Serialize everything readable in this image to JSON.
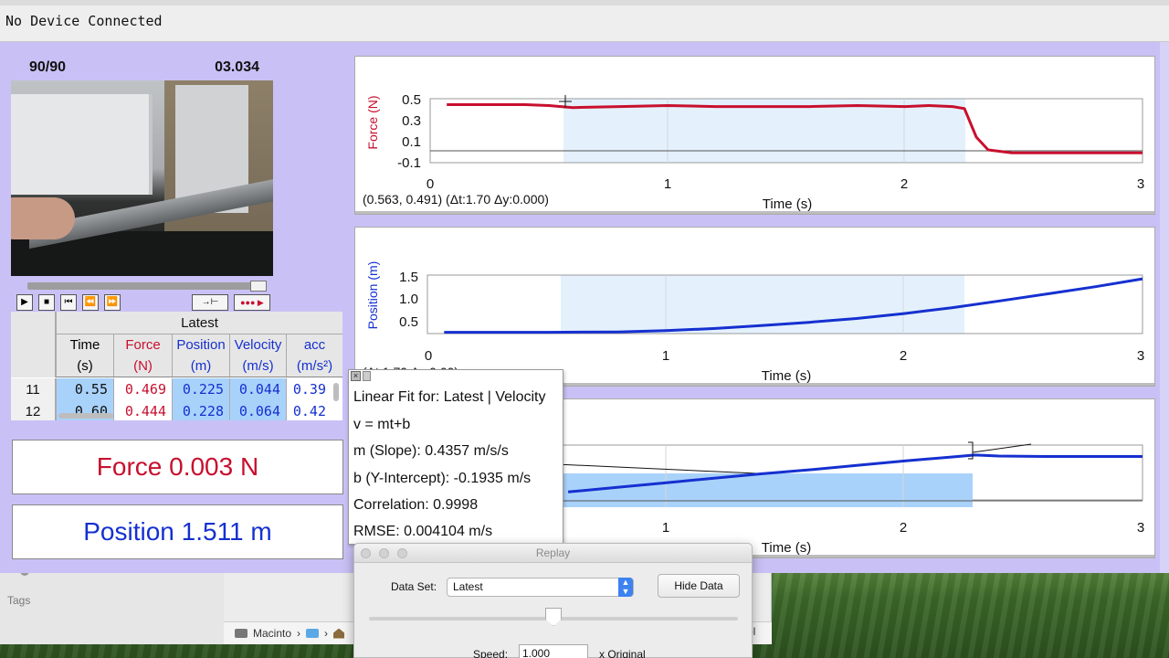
{
  "status_bar": {
    "text": "No Device Connected"
  },
  "video": {
    "frame_counter": "90/90",
    "time": "03.034"
  },
  "table": {
    "group_header": "Latest",
    "columns": [
      {
        "name": "Time",
        "unit": "(s)",
        "color": "#111111"
      },
      {
        "name": "Force",
        "unit": "(N)",
        "color": "#c8102e"
      },
      {
        "name": "Position",
        "unit": "(m)",
        "color": "#1530d0"
      },
      {
        "name": "Velocity",
        "unit": "(m/s)",
        "color": "#1530d0"
      },
      {
        "name": "acc",
        "unit": "(m/s²)",
        "color": "#1530d0"
      }
    ],
    "rows": [
      {
        "index": "11",
        "cells": [
          "0.55",
          "0.469",
          "0.225",
          "0.044",
          "0.39"
        ]
      },
      {
        "index": "12",
        "cells": [
          "0.60",
          "0.444",
          "0.228",
          "0.064",
          "0.42"
        ]
      }
    ]
  },
  "meters": {
    "force": "Force 0.003 N",
    "position": "Position 1.511 m"
  },
  "graphs": {
    "force": {
      "ylabel": "Force (N)",
      "xlabel": "Time (s)",
      "yticks": [
        "0.5",
        "0.3",
        "0.1",
        "-0.1"
      ],
      "xticks": [
        "0",
        "1",
        "2",
        "3"
      ],
      "readout": "(0.563, 0.491) (Δt:1.70 Δy:0.000)",
      "color": "#c8102e"
    },
    "position": {
      "ylabel": "Position (m)",
      "xlabel": "Time (s)",
      "yticks": [
        "1.5",
        "1.0",
        "0.5"
      ],
      "xticks": [
        "0",
        "1",
        "2",
        "3"
      ],
      "readout": "(Δt:1.70 Δy:0.00)",
      "color": "#1530d0"
    },
    "velocity": {
      "xlabel": "Time (s)",
      "xticks": [
        "1",
        "2",
        "3"
      ],
      "color": "#1530d0"
    }
  },
  "chart_data": [
    {
      "type": "line",
      "xlabel": "Time (s)",
      "ylabel": "Force (N)",
      "xlim": [
        0,
        3
      ],
      "ylim": [
        -0.1,
        0.55
      ],
      "selection": [
        0.563,
        2.263
      ],
      "x": [
        0.07,
        0.2,
        0.4,
        0.5,
        0.55,
        0.6,
        0.8,
        1.0,
        1.2,
        1.4,
        1.6,
        1.8,
        2.0,
        2.1,
        2.2,
        2.25,
        2.3,
        2.35,
        2.45,
        2.6,
        2.8,
        3.0
      ],
      "series": [
        {
          "name": "Force",
          "values": [
            0.49,
            0.49,
            0.49,
            0.48,
            0.47,
            0.46,
            0.47,
            0.48,
            0.47,
            0.47,
            0.47,
            0.48,
            0.47,
            0.48,
            0.47,
            0.45,
            0.16,
            0.03,
            0.0,
            0.0,
            0.0,
            0.0
          ]
        }
      ]
    },
    {
      "type": "line",
      "xlabel": "Time (s)",
      "ylabel": "Position (m)",
      "xlim": [
        0,
        3
      ],
      "ylim": [
        0.2,
        1.6
      ],
      "selection": [
        0.563,
        2.263
      ],
      "x": [
        0.07,
        0.5,
        0.8,
        1.0,
        1.2,
        1.4,
        1.6,
        1.8,
        2.0,
        2.2,
        2.4,
        2.6,
        2.8,
        3.0
      ],
      "series": [
        {
          "name": "Position",
          "values": [
            0.23,
            0.23,
            0.24,
            0.27,
            0.32,
            0.39,
            0.47,
            0.56,
            0.68,
            0.82,
            0.98,
            1.15,
            1.32,
            1.51
          ]
        }
      ]
    },
    {
      "type": "line",
      "xlabel": "Time (s)",
      "xlim": [
        0.55,
        3
      ],
      "ylim": [
        -0.1,
        1.0
      ],
      "selection": [
        0.563,
        2.3
      ],
      "x": [
        0.6,
        0.8,
        1.0,
        1.2,
        1.4,
        1.6,
        1.8,
        2.0,
        2.2,
        2.3,
        2.4,
        2.6,
        2.8,
        3.0
      ],
      "series": [
        {
          "name": "Velocity",
          "values": [
            0.06,
            0.15,
            0.24,
            0.33,
            0.42,
            0.5,
            0.59,
            0.68,
            0.76,
            0.8,
            0.78,
            0.77,
            0.77,
            0.77
          ]
        }
      ]
    }
  ],
  "linear_fit": {
    "title": "Linear Fit for: Latest | Velocity",
    "equation": "v = mt+b",
    "slope": "m (Slope): 0.4357 m/s/s",
    "intercept": "b (Y-Intercept): -0.1935 m/s",
    "correlation": "Correlation: 0.9998",
    "rmse": "RMSE: 0.004104 m/s"
  },
  "replay": {
    "title": "Replay",
    "dataset_label": "Data Set:",
    "dataset_value": "Latest",
    "hide_button": "Hide Data",
    "speed_label": "Speed:",
    "speed_value": "1.000",
    "speed_suffix": "x Original",
    "position_fraction": 0.5
  },
  "finder": {
    "tags_label": "Tags",
    "path_label": "Macinto",
    "partial_text": "ol"
  }
}
